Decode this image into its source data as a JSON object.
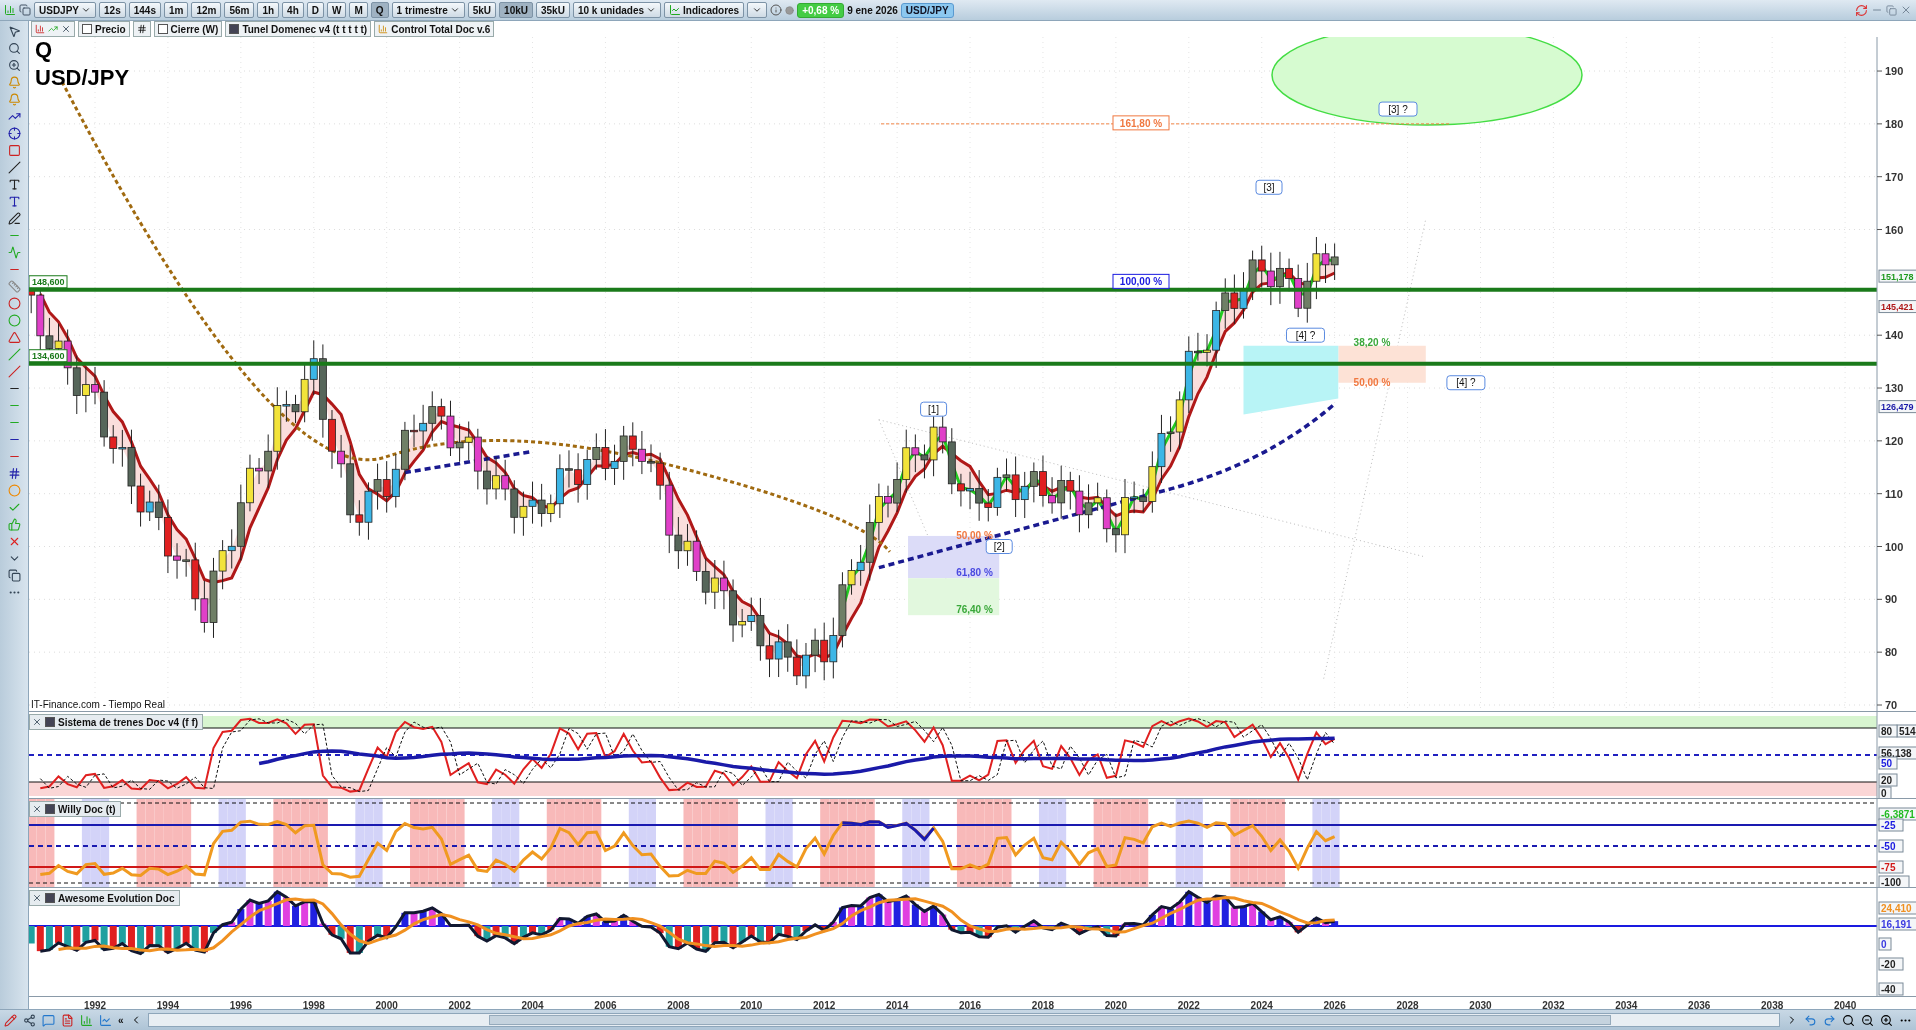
{
  "toolbar": {
    "symbol": "USDJPY",
    "timeframes": [
      {
        "label": "12s",
        "selected": false
      },
      {
        "label": "144s",
        "selected": false
      },
      {
        "label": "1m",
        "selected": false
      },
      {
        "label": "12m",
        "selected": false
      },
      {
        "label": "56m",
        "selected": false
      },
      {
        "label": "1h",
        "selected": false
      },
      {
        "label": "4h",
        "selected": false
      },
      {
        "label": "D",
        "selected": false
      },
      {
        "label": "W",
        "selected": false
      },
      {
        "label": "M",
        "selected": false
      },
      {
        "label": "Q",
        "selected": true
      }
    ],
    "period": "1 trimestre",
    "units": [
      {
        "label": "5kU",
        "selected": false
      },
      {
        "label": "10kU",
        "selected": true
      },
      {
        "label": "35kU",
        "selected": false
      }
    ],
    "unit_select": "10 k unidades",
    "indicators": "Indicadores",
    "change": "+0,68 %",
    "date": "9 ene 2026",
    "pair": "USD/JPY"
  },
  "indicator_bar": {
    "items": [
      {
        "kind": "checkbox",
        "label": "Precio",
        "checked": false
      },
      {
        "kind": "list"
      },
      {
        "kind": "checkbox",
        "label": "Cierre (W)",
        "checked": false
      },
      {
        "kind": "swatch",
        "label": "Tunel Domenec v4 (t t t t t)"
      },
      {
        "kind": "bars",
        "label": "Control Total Doc v.6"
      }
    ]
  },
  "chart": {
    "title": "Q",
    "symbol": "USD/JPY",
    "source": "IT-Finance.com - Tiempo Real",
    "yticks": [
      "190",
      "180",
      "170",
      "160",
      "140",
      "130",
      "120",
      "110",
      "100",
      "90",
      "80",
      "70"
    ],
    "price_tags": [
      {
        "text": "151,178",
        "color": "#1f9a1f"
      },
      {
        "text": "145,421",
        "color": "#b01818"
      },
      {
        "text": "126,479",
        "color": "#1a1aa8"
      }
    ],
    "levels": [
      "148,600",
      "134,600"
    ],
    "fib_labels": [
      {
        "text": "161,80 %",
        "color": "#f07840"
      },
      {
        "text": "100,00 %",
        "color": "#1a1ae0"
      },
      {
        "text": "50,00 %",
        "color": "#f07840"
      },
      {
        "text": "61,80 %",
        "color": "#4a4ae0"
      },
      {
        "text": "76,40 %",
        "color": "#3aa83a"
      },
      {
        "text": "38,20 %",
        "color": "#3aa83a"
      },
      {
        "text": "50,00 %",
        "color": "#f07840"
      }
    ],
    "wave_labels": [
      "[3] ?",
      "[3]",
      "[1]",
      "[2]",
      "[4] ?",
      "[4] ?"
    ]
  },
  "panels": [
    {
      "title": "Sistema de trenes Doc v4 (f f)",
      "axis_labels": [
        {
          "text": "514",
          "color": "#222222"
        },
        {
          "text": "80",
          "color": "#222222"
        },
        {
          "text": "56,138",
          "color": "#222222"
        },
        {
          "text": "50",
          "color": "#1a1ae0"
        },
        {
          "text": "20",
          "color": "#222222"
        },
        {
          "text": "0",
          "color": "#222222"
        }
      ]
    },
    {
      "title": "Willy Doc (t)",
      "axis_labels": [
        {
          "text": "-6,3871",
          "color": "#22bb22"
        },
        {
          "text": "-25",
          "color": "#1a1ae0"
        },
        {
          "text": "-50",
          "color": "#1a1ae0"
        },
        {
          "text": "-75",
          "color": "#d01818"
        },
        {
          "text": "-100",
          "color": "#222222"
        }
      ]
    },
    {
      "title": "Awesome Evolution Doc",
      "axis_labels": [
        {
          "text": "24,410",
          "color": "#f09020"
        },
        {
          "text": "16,191",
          "color": "#3a3ae0"
        },
        {
          "text": "0",
          "color": "#3a3ae0"
        },
        {
          "text": "-20",
          "color": "#222222"
        },
        {
          "text": "-40",
          "color": "#222222"
        }
      ]
    }
  ],
  "xaxis": {
    "years": [
      "1992",
      "1994",
      "1996",
      "1998",
      "2000",
      "2002",
      "2004",
      "2006",
      "2008",
      "2010",
      "2012",
      "2014",
      "2016",
      "2018",
      "2020",
      "2022",
      "2024",
      "2026",
      "2028",
      "2030",
      "2032",
      "2034",
      "2036",
      "2038",
      "2040"
    ]
  },
  "bottom_bar": {
    "collapse": "«"
  }
}
